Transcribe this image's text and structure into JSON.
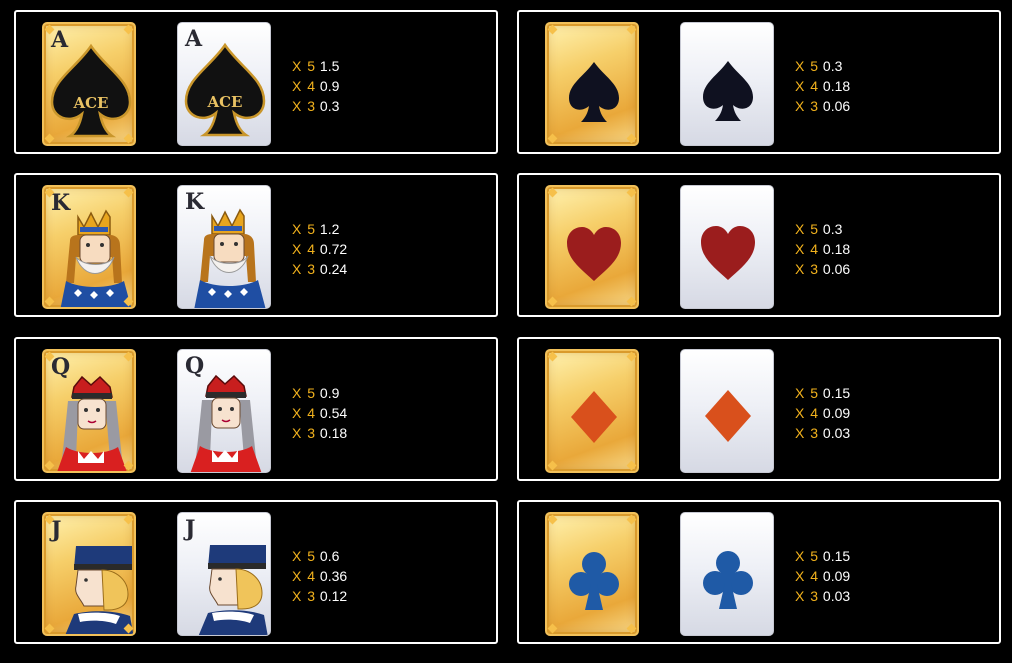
{
  "paytable": [
    {
      "id": "ace",
      "rank": "A",
      "label": "ACE",
      "pays": [
        {
          "mult": "X 5",
          "value": "1.5"
        },
        {
          "mult": "X 4",
          "value": "0.9"
        },
        {
          "mult": "X 3",
          "value": "0.3"
        }
      ]
    },
    {
      "id": "spade",
      "rank": "",
      "pays": [
        {
          "mult": "X 5",
          "value": "0.3"
        },
        {
          "mult": "X 4",
          "value": "0.18"
        },
        {
          "mult": "X 3",
          "value": "0.06"
        }
      ]
    },
    {
      "id": "king",
      "rank": "K",
      "pays": [
        {
          "mult": "X 5",
          "value": "1.2"
        },
        {
          "mult": "X 4",
          "value": "0.72"
        },
        {
          "mult": "X 3",
          "value": "0.24"
        }
      ]
    },
    {
      "id": "heart",
      "rank": "",
      "pays": [
        {
          "mult": "X 5",
          "value": "0.3"
        },
        {
          "mult": "X 4",
          "value": "0.18"
        },
        {
          "mult": "X 3",
          "value": "0.06"
        }
      ]
    },
    {
      "id": "queen",
      "rank": "Q",
      "pays": [
        {
          "mult": "X 5",
          "value": "0.9"
        },
        {
          "mult": "X 4",
          "value": "0.54"
        },
        {
          "mult": "X 3",
          "value": "0.18"
        }
      ]
    },
    {
      "id": "diamond",
      "rank": "",
      "pays": [
        {
          "mult": "X 5",
          "value": "0.15"
        },
        {
          "mult": "X 4",
          "value": "0.09"
        },
        {
          "mult": "X 3",
          "value": "0.03"
        }
      ]
    },
    {
      "id": "jack",
      "rank": "J",
      "pays": [
        {
          "mult": "X 5",
          "value": "0.6"
        },
        {
          "mult": "X 4",
          "value": "0.36"
        },
        {
          "mult": "X 3",
          "value": "0.12"
        }
      ]
    },
    {
      "id": "club",
      "rank": "",
      "pays": [
        {
          "mult": "X 5",
          "value": "0.15"
        },
        {
          "mult": "X 4",
          "value": "0.09"
        },
        {
          "mult": "X 3",
          "value": "0.03"
        }
      ]
    }
  ],
  "colors": {
    "multiplier": "#f2b21d",
    "value": "#ffffff",
    "panel_border": "#ffffff",
    "spade": "#0f1120",
    "heart": "#9b1d1d",
    "diamond": "#d9501c",
    "club": "#1f5aa6"
  },
  "icons": {
    "ace": "ace-of-spades-icon",
    "spade": "spade-icon",
    "king": "king-face-icon",
    "heart": "heart-icon",
    "queen": "queen-face-icon",
    "diamond": "diamond-icon",
    "jack": "jack-face-icon",
    "club": "club-icon"
  }
}
